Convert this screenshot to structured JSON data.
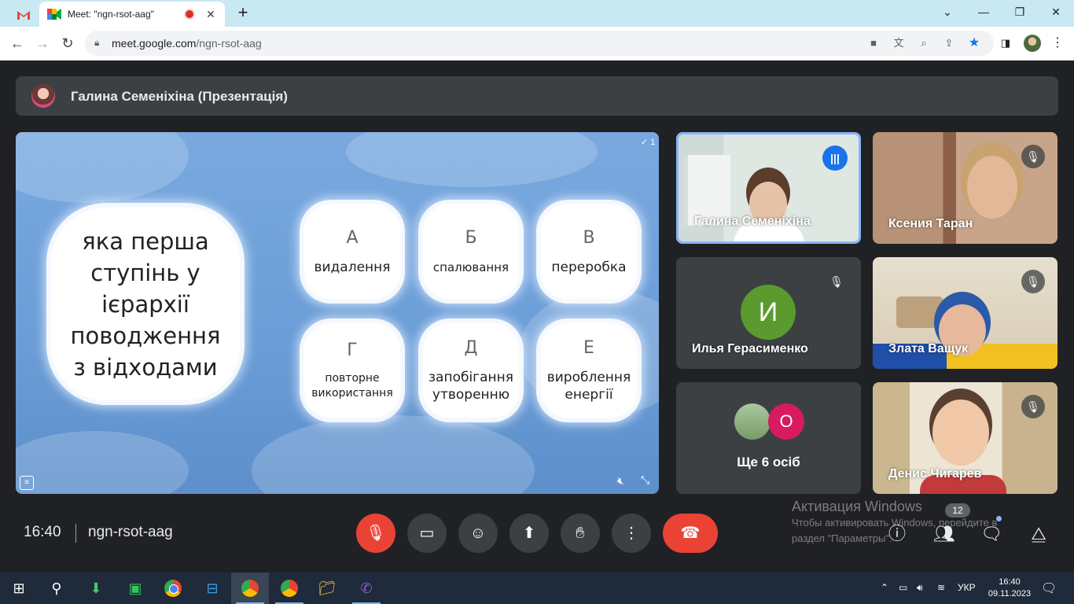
{
  "browser": {
    "tabs": [
      {
        "icon": "gmail-icon",
        "title": ""
      },
      {
        "icon": "meet-icon",
        "title": "Meet: \"ngn-rsot-aag\"",
        "recording": true
      }
    ],
    "new_tab": "+",
    "window_controls": {
      "minimize": "—",
      "restore": "❐",
      "close": "✕",
      "menu": "⌄"
    },
    "url_host": "meet.google.com",
    "url_path": "/ngn-rsot-aag"
  },
  "presenter": {
    "name": "Галина Семеніхіна (Презентація)"
  },
  "slide": {
    "counter": "✓ 1",
    "question": "яка перша ступінь у ієрархії поводження з відходами",
    "options": [
      {
        "letter": "А",
        "text": "видалення"
      },
      {
        "letter": "Б",
        "text": "спалювання"
      },
      {
        "letter": "В",
        "text": "переробка"
      },
      {
        "letter": "Г",
        "text": "повторне використання"
      },
      {
        "letter": "Д",
        "text": "запобігання утворенню"
      },
      {
        "letter": "Е",
        "text": "вироблення енергії"
      }
    ]
  },
  "participants": [
    {
      "name": "Галина Семеніхіна",
      "speaking": true
    },
    {
      "name": "Ксения Таран",
      "muted": true
    },
    {
      "name": "Илья Герасименко",
      "muted": true,
      "initial": "И",
      "color": "#5a9a2f"
    },
    {
      "name": "Злата Ващук",
      "muted": true
    },
    {
      "name": "Ще 6 осіб",
      "initial": "О",
      "color": "#d81b60"
    },
    {
      "name": "Денис Чигарев",
      "muted": true
    }
  ],
  "bottom": {
    "time": "16:40",
    "meeting_code": "ngn-rsot-aag",
    "participants_count": "12"
  },
  "watermark": {
    "line1": "Активация Windows",
    "line2": "Чтобы активировать Windows, перейдите в",
    "line3": "раздел \"Параметры\"."
  },
  "taskbar": {
    "lang": "УКР",
    "time": "16:40",
    "date": "09.11.2023"
  },
  "colors": {
    "end_call": "#ea4335",
    "accent": "#1a73e8"
  }
}
